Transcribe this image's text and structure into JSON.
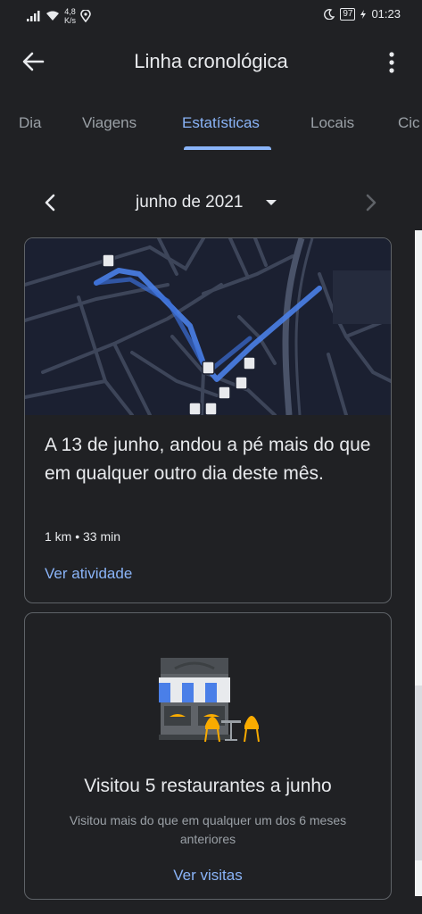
{
  "status_bar": {
    "speed_value": "4,8",
    "speed_unit": "K/s",
    "battery": "97",
    "time": "01:23"
  },
  "app_bar": {
    "title": "Linha cronológica"
  },
  "tabs": [
    {
      "label": "Dia",
      "active": false
    },
    {
      "label": "Viagens",
      "active": false
    },
    {
      "label": "Estatísticas",
      "active": true
    },
    {
      "label": "Locais",
      "active": false
    },
    {
      "label": "Cic",
      "active": false
    }
  ],
  "month_nav": {
    "label": "junho de 2021"
  },
  "walk_card": {
    "headline": "A 13 de junho, andou a pé mais do que em qualquer outro dia deste mês.",
    "meta": "1 km • 33 min",
    "link": "Ver atividade"
  },
  "restaurant_card": {
    "headline": "Visitou 5 restaurantes a junho",
    "subtext": "Visitou mais do que em qualquer um dos 6 meses anteriores",
    "link": "Ver visitas"
  },
  "colors": {
    "background": "#202124",
    "accent": "#8ab4f8",
    "route": "#4a7fe8",
    "map_bg": "#1b2031",
    "road": "#3d4559"
  }
}
